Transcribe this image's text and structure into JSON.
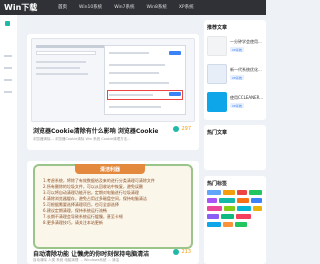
{
  "header": {
    "logo": "Win下载",
    "nav": [
      "首页",
      "Win10系统",
      "Win7系统",
      "Win8系统",
      "XP系统"
    ]
  },
  "colors": {
    "header_bg": "#2f3136",
    "accent": "#22b8a8",
    "hot": "#f59e0b",
    "page_bg": "#eef1f5"
  },
  "articles": [
    {
      "title": "浏览器Cookie清除有什么影响 浏览器Cookie怎么清除",
      "meta": "浏览器清除... 浏览器Cookie清除 Win 系统 Cookie清理方法...",
      "hot": "297"
    },
    {
      "title": "自动清除功能 让懒虎的你时刻保持电脑清洁",
      "meta": "自动清除 人类 系统 电脑清理 ... Windows系统 ... 清洁",
      "hot": "213",
      "banner": "清洁利器",
      "text_lines": [
        "1.考虑系统，将除了有效数据给及来的进行分类清理可清除文件",
        "2.所有删除的垃圾文件，可以从回收站中恢复，避免误删",
        "3.可以将自动清理功能开启，定期对电脑进行垃圾清理",
        "4.清除浏览器缓存，避免占用过多磁盘空间，保持电脑清洁",
        "5.可根据需要选择清理项目，也可全部选择",
        "6.建议定期清理，保持系统运行流畅",
        "7.长期不清理会导致系统运行缓慢，甚至卡顿",
        "8.更多清理技巧，请关注本站更新"
      ]
    }
  ],
  "sidebar": {
    "recommend_title": "推荐文章",
    "recommended": [
      {
        "title": "一分钟学会使用...",
        "tag": "XP系统"
      },
      {
        "title": "新一代系统优化...",
        "tag": "XP系统"
      },
      {
        "title": "使用CCLEANER...",
        "tag": "XP系统"
      }
    ],
    "hot_title": "热门文章",
    "tags_title": "热门标签"
  }
}
